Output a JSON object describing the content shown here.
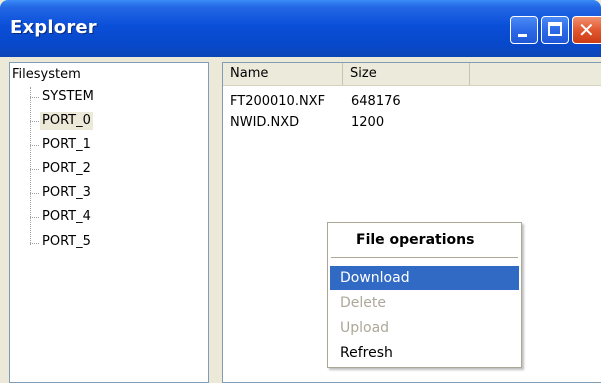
{
  "window": {
    "title": "Explorer",
    "buttons": {
      "minimize": "minimize",
      "maximize": "maximize",
      "close": "✕"
    }
  },
  "tree": {
    "root_label": "Filesystem",
    "items": [
      {
        "label": "SYSTEM",
        "selected": false
      },
      {
        "label": "PORT_0",
        "selected": true
      },
      {
        "label": "PORT_1",
        "selected": false
      },
      {
        "label": "PORT_2",
        "selected": false
      },
      {
        "label": "PORT_3",
        "selected": false
      },
      {
        "label": "PORT_4",
        "selected": false
      },
      {
        "label": "PORT_5",
        "selected": false
      }
    ]
  },
  "file_list": {
    "columns": [
      "Name",
      "Size",
      ""
    ],
    "rows": [
      {
        "name": "FT200010.NXF",
        "size": "648176"
      },
      {
        "name": "NWID.NXD",
        "size": "1200"
      }
    ]
  },
  "context_menu": {
    "title": "File operations",
    "items": [
      {
        "label": "Download",
        "state": "highlighted"
      },
      {
        "label": "Delete",
        "state": "disabled"
      },
      {
        "label": "Upload",
        "state": "disabled"
      },
      {
        "label": "Refresh",
        "state": "enabled"
      }
    ]
  },
  "colors": {
    "titlebar": "#0a4fd8",
    "selection": "#316ac5",
    "disabled_text": "#aca899",
    "close_button": "#e2582f"
  }
}
